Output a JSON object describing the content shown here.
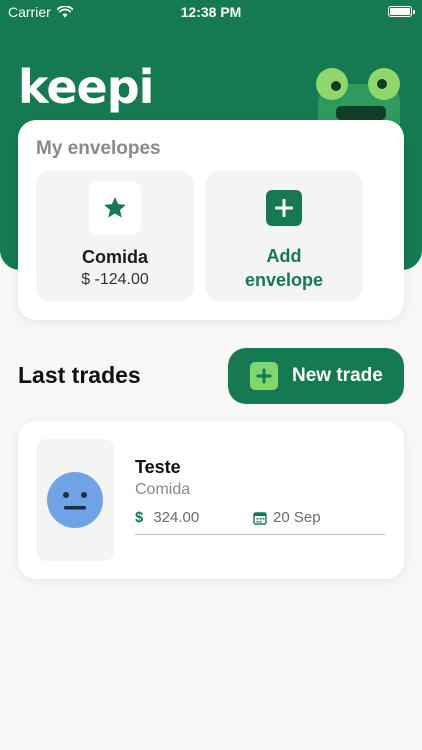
{
  "status_bar": {
    "carrier": "Carrier",
    "time": "12:38 PM"
  },
  "header": {
    "logo_text": "keepi"
  },
  "envelopes": {
    "title": "My envelopes",
    "items": [
      {
        "name": "Comida",
        "amount": "$ -124.00",
        "icon": "star-icon"
      }
    ],
    "add_label_line1": "Add",
    "add_label_line2": "envelope"
  },
  "trades": {
    "title": "Last trades",
    "new_trade_label": "New trade",
    "items": [
      {
        "title": "Teste",
        "category": "Comida",
        "currency_symbol": "$",
        "amount": "324.00",
        "date": "20 Sep",
        "icon": "neutral-face-icon"
      }
    ]
  },
  "colors": {
    "brand": "#157a52",
    "accent_light": "#7ed86f",
    "avatar_blue": "#6fa3e6"
  }
}
